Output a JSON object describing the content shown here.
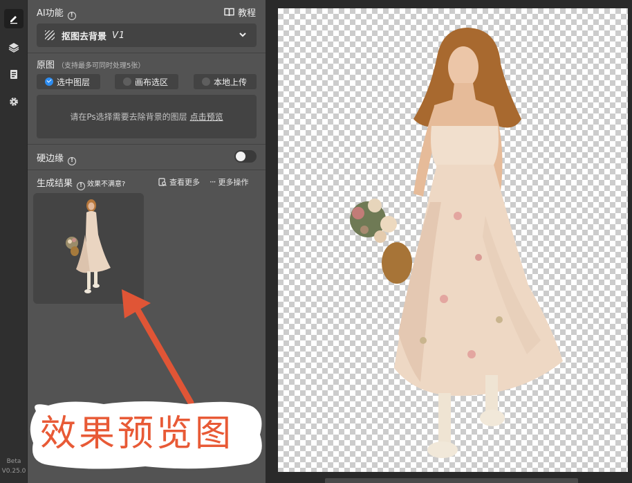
{
  "rail": {
    "items": [
      {
        "name": "edit",
        "icon": "pen-icon",
        "active": true
      },
      {
        "name": "layers",
        "icon": "layers-icon",
        "active": false
      },
      {
        "name": "tasks",
        "icon": "clipboard-icon",
        "active": false
      },
      {
        "name": "settings",
        "icon": "gear-icon",
        "active": false
      }
    ],
    "beta_label": "Beta",
    "version": "V0.25.0"
  },
  "ai_section": {
    "title": "AI功能",
    "tutorial_label": "教程",
    "tool_selected": "抠图去背景",
    "tool_version": "V1"
  },
  "source": {
    "title": "原图",
    "hint": "（支持最多可同时处理5张）",
    "options": [
      {
        "label": "选中图层",
        "checked": true
      },
      {
        "label": "画布选区",
        "checked": false
      },
      {
        "label": "本地上传",
        "checked": false
      }
    ],
    "placeholder": "请在Ps选择需要去除背景的图层",
    "preview_link": "点击预览"
  },
  "hard_edge": {
    "title": "硬边缘",
    "enabled": false
  },
  "results": {
    "title": "生成结果",
    "unsatisfied": "效果不满意?",
    "view_more": "查看更多",
    "more_actions": "更多操作"
  },
  "annotation": {
    "text": "效果预览图",
    "color": "#e85a36"
  },
  "colors": {
    "panel_bg": "#535353",
    "rail_bg": "#2f2f2f",
    "accent": "#2d8cf0"
  }
}
